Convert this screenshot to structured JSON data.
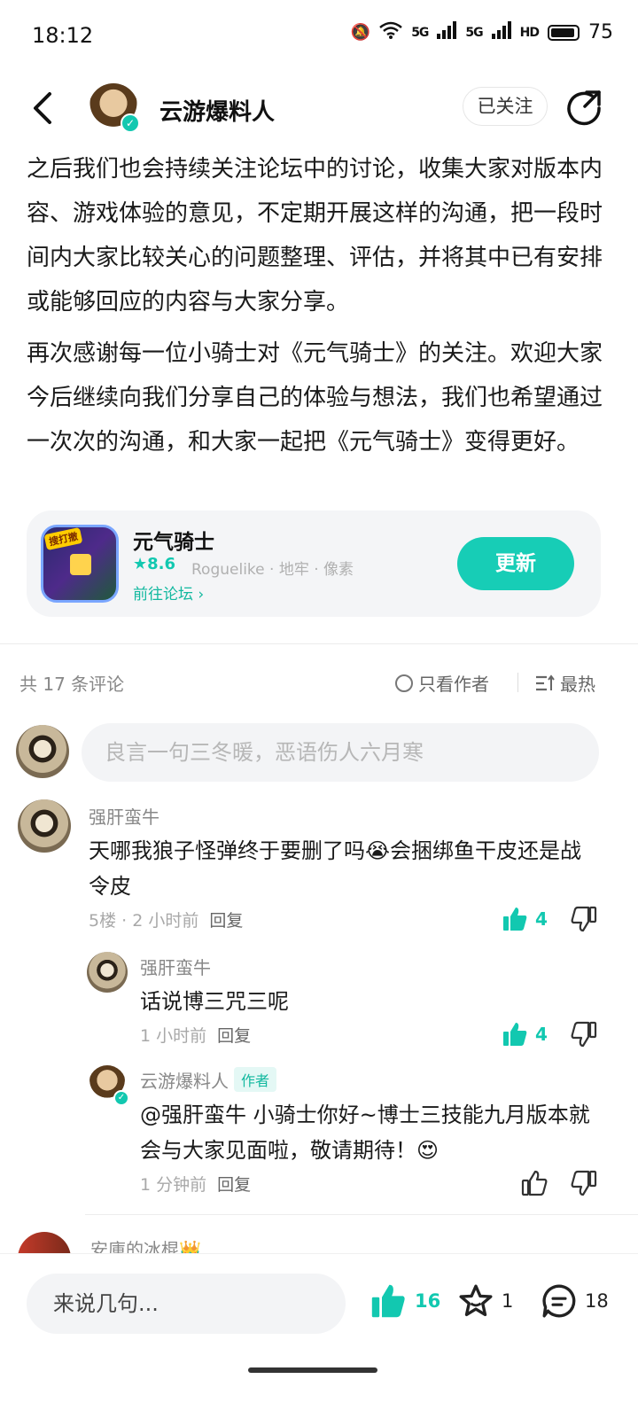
{
  "status": {
    "time": "18:12",
    "battery": "75",
    "network_1": "5G",
    "network_2": "5G",
    "hd": "HD"
  },
  "header": {
    "author_name": "云游爆料人",
    "follow_label": "已关注"
  },
  "article": {
    "paragraphs": [
      "之后我们也会持续关注论坛中的讨论，收集大家对版本内容、游戏体验的意见，不定期开展这样的沟通，把一段时间内大家比较关心的问题整理、评估，并将其中已有安排或能够回应的内容与大家分享。",
      "再次感谢每一位小骑士对《元气骑士》的关注。欢迎大家今后继续向我们分享自己的体验与想法，我们也希望通过一次次的沟通，和大家一起把《元气骑士》变得更好。"
    ]
  },
  "game_card": {
    "icon_tag": "搜打撤",
    "name": "元气骑士",
    "rating": "★8.6",
    "tags": "Roguelike · 地牢 · 像素",
    "forum_link": "前往论坛 ›",
    "update_label": "更新",
    "accent": "#17cdb6"
  },
  "comments_head": {
    "count_label": "共 17 条评论",
    "only_author_label": "只看作者",
    "sort_label": "最热"
  },
  "comment_input": {
    "placeholder": "良言一句三冬暖，恶语伤人六月寒"
  },
  "comments": [
    {
      "name": "强肝蛮牛",
      "text": "天哪我狼子怪弹终于要删了吗😭会捆绑鱼干皮还是战令皮",
      "meta": "5楼 · 2 小时前",
      "reply_label": "回复",
      "likes": "4"
    }
  ],
  "replies": [
    {
      "name": "强肝蛮牛",
      "text": "话说博三咒三呢",
      "meta": "1 小时前",
      "reply_label": "回复",
      "likes": "4"
    },
    {
      "name": "云游爆料人",
      "badge": "作者",
      "mention": "@强肝蛮牛",
      "text": "小骑士你好~博士三技能九月版本就会与大家见面啦，敬请期待！😍",
      "meta": "1 分钟前",
      "reply_label": "回复"
    }
  ],
  "partial_comment": {
    "name": "安庫的冰棍👑"
  },
  "bottom_bar": {
    "input_placeholder": "来说几句...",
    "likes": "16",
    "favorites": "1",
    "comments": "18"
  }
}
